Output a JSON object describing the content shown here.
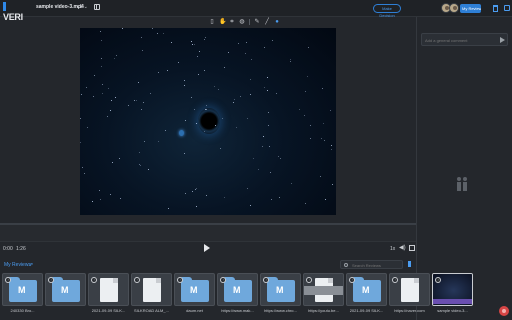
{
  "app": {
    "logo_text": "VERI"
  },
  "header": {
    "filename": "sample video-3.mp4",
    "version": "v1 ⌄",
    "make_decision_label": "Make Decision",
    "my_reviews_label": "My Reviews ▾"
  },
  "toolbar": {
    "tools": [
      {
        "name": "document-tool-icon",
        "glyph": "▯"
      },
      {
        "name": "hand-tool-icon",
        "glyph": "✋"
      },
      {
        "name": "crop-tool-icon",
        "glyph": "⌗"
      },
      {
        "name": "text-tool-icon",
        "glyph": "◍"
      },
      {
        "name": "pen-tool-icon",
        "glyph": "✎"
      },
      {
        "name": "line-tool-icon",
        "glyph": "╱"
      },
      {
        "name": "color-picker-icon",
        "glyph": "●"
      }
    ]
  },
  "player": {
    "current_time": "0:00",
    "duration": "1:26",
    "speed": "1x"
  },
  "comments": {
    "placeholder": "Add a general comment"
  },
  "reviews": {
    "label": "My Reviews",
    "search_placeholder": "Search Reviews",
    "items": [
      {
        "caption": "240330 Bro...",
        "kind": "folder",
        "badge": "M"
      },
      {
        "caption": "",
        "kind": "folder",
        "badge": "M"
      },
      {
        "caption": "2021-09-09 SILK...",
        "kind": "doc",
        "badge": "M"
      },
      {
        "caption": "SILKROAD ALM_...",
        "kind": "doc",
        "badge": "M"
      },
      {
        "caption": "daum.net",
        "kind": "folder",
        "badge": "M"
      },
      {
        "caption": "https://www.mak...",
        "kind": "folder",
        "badge": "M"
      },
      {
        "caption": "https://www.chro...",
        "kind": "folder",
        "badge": "M"
      },
      {
        "caption": "https://youtu.be...",
        "kind": "docbanner",
        "badge": "M"
      },
      {
        "caption": "2021-09-09 SILK...",
        "kind": "folder",
        "badge": "M"
      },
      {
        "caption": "https://naver.com",
        "kind": "doc",
        "badge": "M"
      },
      {
        "caption": "sample video-3...",
        "kind": "video",
        "badge": "M"
      }
    ]
  },
  "colors": {
    "accent": "#2e7fd6",
    "background": "#24272c"
  }
}
